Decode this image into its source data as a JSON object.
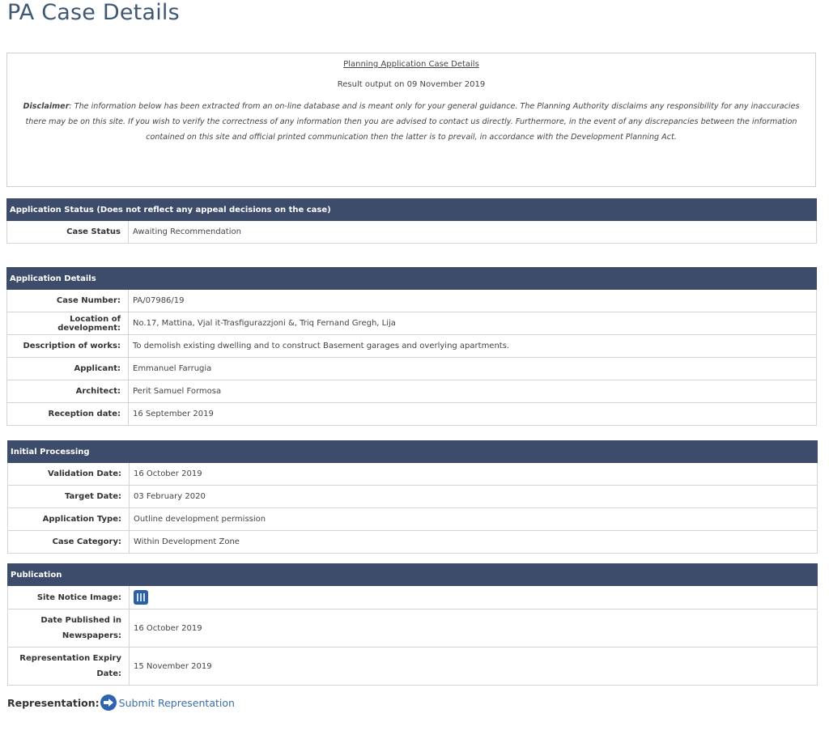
{
  "page_title": "PA Case Details",
  "disclaimer": {
    "heading": "Planning Application Case Details",
    "output_line": "Result output on 09 November 2019",
    "label": "Disclaimer",
    "text": ": The information below has been extracted from an on-line database and is meant only for your general guidance. The Planning Authority disclaims any responsibility for any inaccuracies there may be on this site. If you wish to verify the correctness of any information then you are advised to contact us directly. Furthermore, in the event of any discrepancies between the information contained on this site and official printed communication then the latter is to prevail, in accordance with the Development Planning Act."
  },
  "application_status": {
    "header": "Application Status (Does not reflect any appeal decisions on the case)",
    "rows": [
      {
        "label": "Case Status",
        "value": "Awaiting Recommendation"
      }
    ]
  },
  "application_details": {
    "header": "Application Details",
    "rows": [
      {
        "label": "Case Number:",
        "value": "PA/07986/19"
      },
      {
        "label": "Location of development:",
        "value": "No.17, Mattina, Vjal it-Trasfigurazzjoni &, Triq Fernand Gregh, Lija"
      },
      {
        "label": "Description of works:",
        "value": "To demolish existing dwelling and to construct Basement garages and overlying apartments."
      },
      {
        "label": "Applicant:",
        "value": "Emmanuel Farrugia"
      },
      {
        "label": "Architect:",
        "value": "Perit Samuel Formosa"
      },
      {
        "label": "Reception date:",
        "value": "16 September 2019"
      }
    ]
  },
  "initial_processing": {
    "header": "Initial Processing",
    "rows": [
      {
        "label": "Validation Date:",
        "value": "16 October 2019"
      },
      {
        "label": "Target Date:",
        "value": "03 February 2020"
      },
      {
        "label": "Application Type:",
        "value": "Outline development permission"
      },
      {
        "label": "Case Category:",
        "value": "Within Development Zone"
      }
    ]
  },
  "publication": {
    "header": "Publication",
    "site_notice_label": "Site Notice Image:",
    "site_notice_icon": "site-notice-image-icon",
    "newspaper_label_1": "Date Published in",
    "newspaper_label_2": "Newspapers:",
    "newspaper_value": "16 October 2019",
    "expiry_label_1": "Representation Expiry",
    "expiry_label_2": "Date:",
    "expiry_value": "15 November 2019"
  },
  "representation": {
    "label": "Representation:",
    "icon": "arrow-right-icon",
    "link_text": "Submit Representation"
  },
  "colors": {
    "title": "#3e5873",
    "header_bg": "#3e4c6b",
    "link": "#3b6fa8"
  }
}
